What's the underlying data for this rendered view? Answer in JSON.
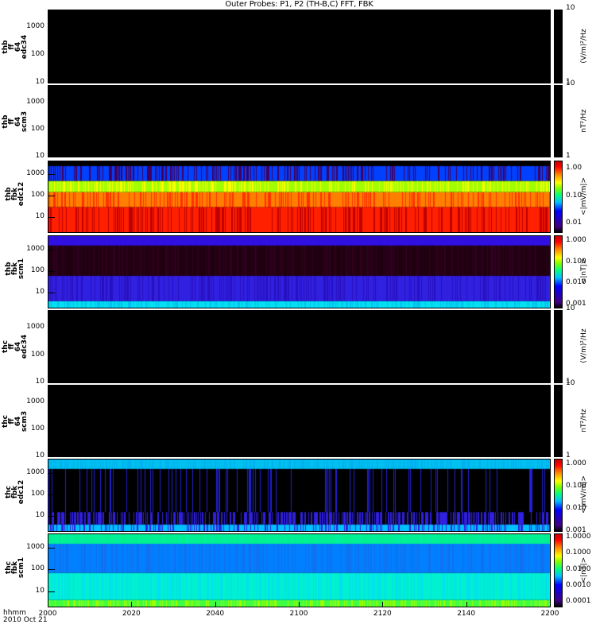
{
  "title": "Outer Probes: P1, P2 (TH-B,C) FFT, FBK",
  "x_axis": {
    "label": "hhmm",
    "date": "2010 Oct 21",
    "ticks": [
      "2000",
      "2020",
      "2040",
      "2100",
      "2120",
      "2140",
      "2200"
    ]
  },
  "chart_data": {
    "type": "heatmap",
    "title": "Outer Probes: P1, P2 (TH-B,C) FFT, FBK",
    "xlabel": "hhmm 2010 Oct 21",
    "xlim": [
      "2000",
      "2200"
    ],
    "panels": [
      {
        "label": [
          "thb",
          "ff",
          "64",
          "edc34"
        ],
        "kind": "ff",
        "ylim": [
          10,
          4096
        ],
        "yticks": [
          "1000",
          "100",
          "10"
        ],
        "cbar_ticks": [
          "10",
          "1"
        ],
        "cbar_range": [
          1,
          10
        ],
        "unit": "(V/m)²/Hz",
        "cbar_style": "black",
        "bands": []
      },
      {
        "label": [
          "thb",
          "ff",
          "64",
          "scm3"
        ],
        "kind": "ff",
        "ylim": [
          10,
          4096
        ],
        "yticks": [
          "1000",
          "100",
          "10"
        ],
        "cbar_ticks": [
          "10",
          "1"
        ],
        "cbar_range": [
          1,
          10
        ],
        "unit": "nT²/Hz",
        "cbar_style": "black",
        "bands": []
      },
      {
        "label": [
          "thb",
          "fbk",
          "edc12"
        ],
        "kind": "fbk",
        "ylim": [
          2,
          4096
        ],
        "yticks": [
          "1000",
          "100",
          "10"
        ],
        "cbar_ticks": [
          "1.00",
          "0.10",
          "0.01"
        ],
        "cbar_range": [
          0.005,
          2
        ],
        "unit": "<|mV/m|>",
        "cbar_style": "rainbow",
        "bands": [
          {
            "from": 2,
            "to": 30,
            "color": "#ff2000",
            "alt": "#c00000"
          },
          {
            "from": 30,
            "to": 150,
            "color": "#ff8000",
            "alt": "#ff3000"
          },
          {
            "from": 150,
            "to": 500,
            "color": "#a0ff00",
            "alt": "#ffff00"
          },
          {
            "from": 500,
            "to": 2500,
            "color": "#0040ff",
            "alt": "#400060"
          },
          {
            "from": 2500,
            "to": 4096,
            "color": "#000000",
            "alt": "#000000"
          }
        ]
      },
      {
        "label": [
          "thb",
          "fbk",
          "scm1"
        ],
        "kind": "fbk",
        "ylim": [
          2,
          4096
        ],
        "yticks": [
          "1000",
          "100",
          "10"
        ],
        "cbar_ticks": [
          "1.000",
          "0.100",
          "0.010",
          "0.001"
        ],
        "cbar_range": [
          0.0007,
          2
        ],
        "unit": "<|nT|>",
        "cbar_style": "rainbow",
        "bands": [
          {
            "from": 2,
            "to": 4,
            "color": "#00e0f0",
            "alt": "#00c0f0"
          },
          {
            "from": 4,
            "to": 60,
            "color": "#3020e0",
            "alt": "#2810c0"
          },
          {
            "from": 60,
            "to": 1500,
            "color": "#200010",
            "alt": "#300020"
          },
          {
            "from": 1500,
            "to": 4096,
            "color": "#3010e0",
            "alt": "#3010e0"
          }
        ]
      },
      {
        "label": [
          "thc",
          "ff",
          "64",
          "edc34"
        ],
        "kind": "ff",
        "ylim": [
          10,
          4096
        ],
        "yticks": [
          "1000",
          "100",
          "10"
        ],
        "cbar_ticks": [
          "10",
          "1"
        ],
        "cbar_range": [
          1,
          10
        ],
        "unit": "(V/m)²/Hz",
        "cbar_style": "black",
        "bands": []
      },
      {
        "label": [
          "thc",
          "ff",
          "64",
          "scm3"
        ],
        "kind": "ff",
        "ylim": [
          10,
          4096
        ],
        "yticks": [
          "1000",
          "100",
          "10"
        ],
        "cbar_ticks": [
          "10",
          "1"
        ],
        "cbar_range": [
          1,
          10
        ],
        "unit": "nT²/Hz",
        "cbar_style": "black",
        "bands": []
      },
      {
        "label": [
          "thc",
          "fbk",
          "edc12"
        ],
        "kind": "fbk",
        "ylim": [
          2,
          4096
        ],
        "yticks": [
          "1000",
          "100",
          "10"
        ],
        "cbar_ticks": [
          "1.000",
          "0.100",
          "0.010",
          "0.001"
        ],
        "cbar_range": [
          0.001,
          2
        ],
        "unit": "<|mV/m|>",
        "cbar_style": "rainbow",
        "bands": [
          {
            "from": 2,
            "to": 4,
            "color": "#00c0ff",
            "alt": "#3020e0"
          },
          {
            "from": 4,
            "to": 15,
            "color": "#000000",
            "alt": "#3020e0",
            "sparse": 0.5
          },
          {
            "from": 15,
            "to": 1500,
            "color": "#000000",
            "alt": "#2020d0",
            "sparse": 0.12
          },
          {
            "from": 1500,
            "to": 4096,
            "color": "#00c0f0",
            "alt": "#00b0f0"
          }
        ]
      },
      {
        "label": [
          "thc",
          "fbk",
          "scm1"
        ],
        "kind": "fbk",
        "ylim": [
          2,
          4096
        ],
        "yticks": [
          "1000",
          "100",
          "10"
        ],
        "cbar_ticks": [
          "1.0000",
          "0.1000",
          "0.0100",
          "0.0010",
          "0.0001"
        ],
        "cbar_range": [
          5e-05,
          2
        ],
        "unit": "<|nT|>",
        "cbar_style": "rainbow",
        "bands": [
          {
            "from": 2,
            "to": 4,
            "color": "#40ff40",
            "alt": "#a0ff00"
          },
          {
            "from": 4,
            "to": 70,
            "color": "#00f0d0",
            "alt": "#00e0f0"
          },
          {
            "from": 70,
            "to": 1500,
            "color": "#0080ff",
            "alt": "#1070f0"
          },
          {
            "from": 1500,
            "to": 4096,
            "color": "#00f090",
            "alt": "#00f0a0"
          }
        ]
      }
    ]
  }
}
